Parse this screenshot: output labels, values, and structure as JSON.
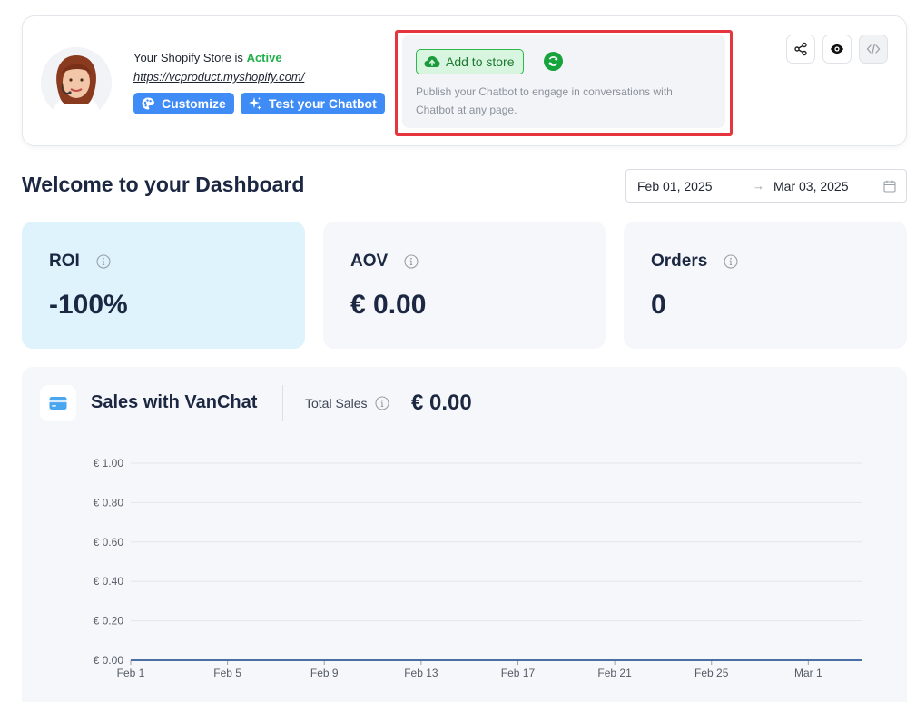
{
  "store": {
    "status_prefix": "Your Shopify Store is",
    "status": "Active",
    "url": "https://vcproduct.myshopify.com/",
    "customize_label": "Customize",
    "test_label": "Test your Chatbot"
  },
  "publish": {
    "add_label": "Add to store",
    "description": "Publish your Chatbot to engage in conversations with Chatbot at any page."
  },
  "header_actions": [
    "share-icon",
    "eye-icon",
    "code-icon"
  ],
  "welcome": "Welcome to your Dashboard",
  "date_range": {
    "start": "Feb 01, 2025",
    "end": "Mar 03, 2025",
    "separator": "→"
  },
  "metrics": {
    "roi": {
      "label": "ROI",
      "value": "-100%"
    },
    "aov": {
      "label": "AOV",
      "value": "€ 0.00"
    },
    "orders": {
      "label": "Orders",
      "value": "0"
    }
  },
  "sales": {
    "title": "Sales with VanChat",
    "total_label": "Total Sales",
    "total_value": "€ 0.00"
  },
  "colors": {
    "accent_blue": "#3f8cf6",
    "active_green": "#22b14c",
    "highlight_red": "#e5353f",
    "line_blue": "#4a6fa5"
  },
  "chart_data": {
    "type": "line",
    "x": [
      "Feb 1",
      "Feb 5",
      "Feb 9",
      "Feb 13",
      "Feb 17",
      "Feb 21",
      "Feb 25",
      "Mar 1"
    ],
    "series": [
      {
        "values": [
          0,
          0,
          0,
          0,
          0,
          0,
          0,
          0
        ]
      }
    ],
    "y_ticks": [
      "€ 0.00",
      "€ 0.20",
      "€ 0.40",
      "€ 0.60",
      "€ 0.80",
      "€ 1.00"
    ],
    "ylim": [
      0,
      1
    ],
    "grid": true
  }
}
